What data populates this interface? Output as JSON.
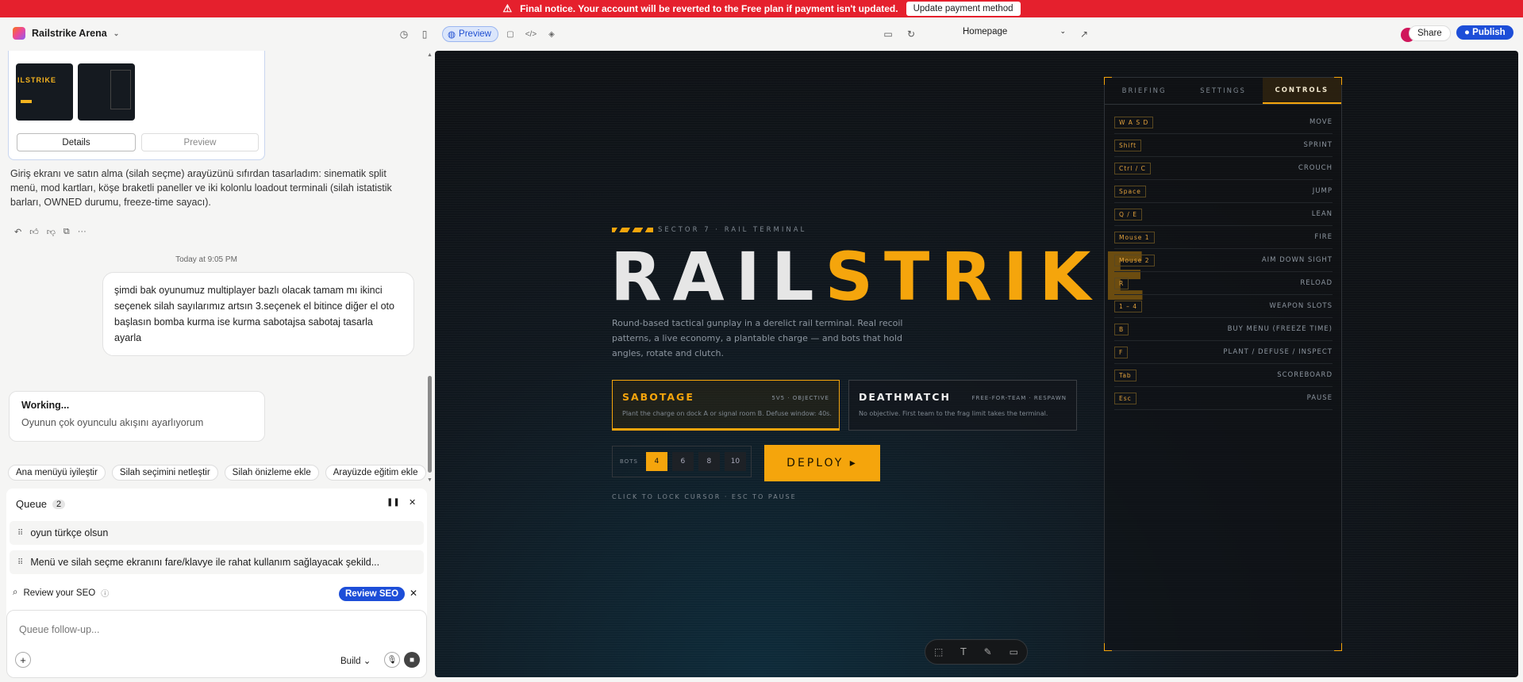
{
  "banner": {
    "message": "Final notice. Your account will be reverted to the Free plan if payment isn't updated.",
    "button": "Update payment method"
  },
  "header": {
    "project": "Railstrike Arena",
    "preview_label": "Preview",
    "page_select": "Homepage",
    "share": "Share",
    "publish": "Publish"
  },
  "chat": {
    "card": {
      "details": "Details",
      "preview": "Preview",
      "thumb_text": "ILSTRIKE"
    },
    "assistant_message": "Giriş ekranı ve satın alma (silah seçme) arayüzünü sıfırdan tasarladım: sinematik split menü, mod kartları, köşe braketli paneller ve iki kolonlu loadout terminali (silah istatistik barları, OWNED durumu, freeze-time sayacı).",
    "timestamp": "Today at 9:05 PM",
    "user_message": "şimdi bak oyunumuz multiplayer bazlı olacak tamam mı ikinci seçenek silah sayılarımız artsın 3.seçenek el bitince diğer el oto başlasın bomba kurma ise kurma sabotajsa sabotaj tasarla ayarla",
    "working_title": "Working...",
    "working_status": "Oyunun çok oyunculu akışını ayarlıyorum",
    "suggestions": [
      "Ana menüyü iyileştir",
      "Silah seçimini netleştir",
      "Silah önizleme ekle",
      "Arayüzde eğitim ekle"
    ],
    "queue": {
      "title": "Queue",
      "count": "2",
      "items": [
        "oyun türkçe olsun",
        "Menü ve silah seçme ekranını fare/klavye ile rahat kullanım sağlayacak şekild..."
      ]
    },
    "seo": {
      "label": "Review your SEO",
      "button": "Review SEO"
    },
    "input": {
      "placeholder": "Queue follow-up...",
      "mode": "Build"
    }
  },
  "game": {
    "sector": "SECTOR 7 · RAIL TERMINAL",
    "title_a": "RAIL",
    "title_b": "STRIKE",
    "description": "Round-based tactical gunplay in a derelict rail terminal. Real recoil patterns, a live economy, a plantable charge — and bots that hold angles, rotate and clutch.",
    "modes": [
      {
        "name": "SABOTAGE",
        "tag": "5V5 · OBJECTIVE",
        "desc": "Plant the charge on dock A or signal room B. Defuse window: 40s."
      },
      {
        "name": "DEATHMATCH",
        "tag": "FREE-FOR-TEAM · RESPAWN",
        "desc": "No objective. First team to the frag limit takes the terminal."
      }
    ],
    "bots_label": "BOTS",
    "bot_options": [
      "4",
      "6",
      "8",
      "10"
    ],
    "bots_selected": "4",
    "deploy": "DEPLOY ▸",
    "hint": "CLICK TO LOCK CURSOR · ESC TO PAUSE",
    "tabs": [
      "BRIEFING",
      "SETTINGS",
      "CONTROLS"
    ],
    "active_tab": "CONTROLS",
    "controls": [
      {
        "key": "W A S D",
        "action": "MOVE"
      },
      {
        "key": "Shift",
        "action": "SPRINT"
      },
      {
        "key": "Ctrl / C",
        "action": "CROUCH"
      },
      {
        "key": "Space",
        "action": "JUMP"
      },
      {
        "key": "Q / E",
        "action": "LEAN"
      },
      {
        "key": "Mouse 1",
        "action": "FIRE"
      },
      {
        "key": "Mouse 2",
        "action": "AIM DOWN SIGHT"
      },
      {
        "key": "R",
        "action": "RELOAD"
      },
      {
        "key": "1 – 4",
        "action": "WEAPON SLOTS"
      },
      {
        "key": "B",
        "action": "BUY MENU (FREEZE TIME)"
      },
      {
        "key": "F",
        "action": "PLANT / DEFUSE / INSPECT"
      },
      {
        "key": "Tab",
        "action": "SCOREBOARD"
      },
      {
        "key": "Esc",
        "action": "PAUSE"
      }
    ]
  },
  "colors": {
    "accent": "#f5a50c",
    "banner": "#e5202d",
    "publish": "#1d4ed8"
  }
}
